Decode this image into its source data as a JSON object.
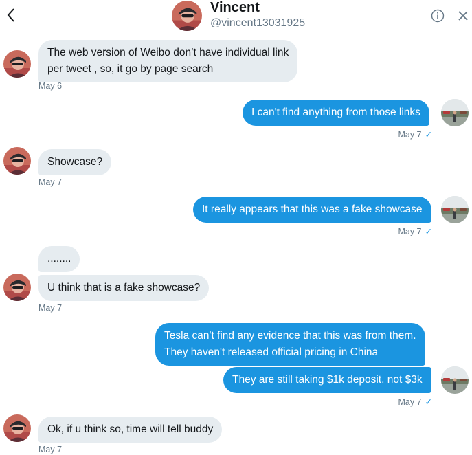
{
  "header": {
    "name": "Vincent",
    "handle": "@vincent13031925"
  },
  "messages": [
    {
      "direction": "received",
      "lines": [
        "The web version of Weibo don’t have individual link",
        "per tweet , so, it go by page search"
      ]
    },
    {
      "direction": "received_time",
      "time": "May 6"
    },
    {
      "direction": "sent",
      "text": "I can't find anything from those links"
    },
    {
      "direction": "sent_time",
      "time": "May 7",
      "read": "✓"
    },
    {
      "direction": "received",
      "text": "Showcase?"
    },
    {
      "direction": "received_time",
      "time": "May 7"
    },
    {
      "direction": "sent",
      "text": "It really appears that this was a fake showcase"
    },
    {
      "direction": "sent_time",
      "time": "May 7",
      "read": "✓"
    },
    {
      "direction": "received",
      "text": "........"
    },
    {
      "direction": "received",
      "text": "U think that is a fake showcase?"
    },
    {
      "direction": "received_time",
      "time": "May 7"
    },
    {
      "direction": "sent",
      "lines": [
        "Tesla can't find any evidence that this was from them.",
        "They haven't released official pricing in China"
      ]
    },
    {
      "direction": "sent",
      "text": "They are still taking $1k deposit, not $3k"
    },
    {
      "direction": "sent_time",
      "time": "May 7",
      "read": "✓"
    },
    {
      "direction": "received",
      "text": "Ok, if u think so, time will tell buddy"
    },
    {
      "direction": "received_time",
      "time": "May 7"
    }
  ],
  "icons": {
    "back": "chevron-left-icon",
    "info": "info-icon",
    "close": "close-icon"
  },
  "colors": {
    "sent_bubble": "#1b95e0",
    "received_bubble": "#e6ecf0",
    "timestamp": "#657786"
  }
}
